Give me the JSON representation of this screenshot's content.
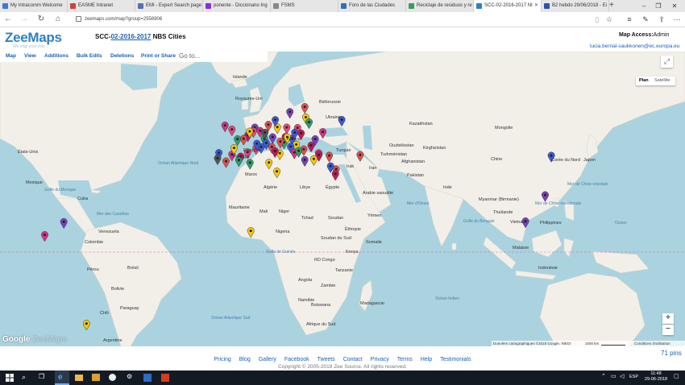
{
  "browser": {
    "tabs": [
      {
        "title": "My Intracomm Welcome",
        "color": "#3a7bd5"
      },
      {
        "title": "EASME Intranet",
        "color": "#d04040"
      },
      {
        "title": "EMI - Expert Search page",
        "color": "#5a6fb0"
      },
      {
        "title": "ponente - Diccionario Ing",
        "color": "#8a2be2"
      },
      {
        "title": "FSMS",
        "color": "#888888"
      },
      {
        "title": "Foro de las Ciudades",
        "color": "#2f6fb5"
      },
      {
        "title": "Reciclaje de residuos y re",
        "color": "#3a9c5a"
      },
      {
        "title": "SCC-02-2016-2017 NI",
        "color": "#2f7fc4",
        "active": true
      },
      {
        "title": "B2 hebdo 29/06/2018 - Ei",
        "color": "#2f4fb5"
      }
    ],
    "url": "zeemaps.com/map?group=2558906"
  },
  "site": {
    "logo": "ZeeMaps",
    "tagline": "We map your lists",
    "title_prefix": "SCC-",
    "title_link": "02-2016-2017",
    "title_suffix": " NBS Cities",
    "access_label": "Map Access:",
    "access_value": "Admin",
    "user_email": "lucia.bernal-saukkonen@ec.europa.eu"
  },
  "menu": {
    "items": [
      "Map",
      "View",
      "Additions",
      "Bulk Edits",
      "Deletions",
      "Print or Share"
    ],
    "goto_placeholder": "Go to..."
  },
  "map": {
    "type_plan": "Plan",
    "type_satellite": "Satellite",
    "zoom_in": "+",
    "zoom_out": "−",
    "google": "Google",
    "zeemaps_watermark": "ZeeMaps",
    "attribution": "Données cartographiques ©2018 Google, INEGI",
    "scale": "1000 km",
    "terms": "Conditions d'utilisation",
    "labels": {
      "iceland": "Islande",
      "uk": "Royaume-Uni",
      "belarus": "Biélorussie",
      "ukraine": "Ukraine",
      "kazakhstan": "Kazakhstan",
      "mongolia": "Mongolie",
      "uzbekistan": "Ouzbékistan",
      "turkmenistan": "Turkménistan",
      "kyrgyzstan": "Kirghizistan",
      "france": "France",
      "spain": "Espagne",
      "portugal": "Portugal",
      "turkey": "Turquie",
      "iran": "Iran",
      "afghanistan": "Afghanistan",
      "pakistan": "Pakistan",
      "china": "Chine",
      "nkorea": "Corée du Nord",
      "japan": "Japon",
      "morocco": "Maroc",
      "algeria": "Algérie",
      "libya": "Libye",
      "egypt": "Égypte",
      "iraq": "Irak",
      "saudi": "Arabie saoudite",
      "india": "Inde",
      "myanmar": "Myanmar (Birmanie)",
      "thailand": "Thaïlande",
      "vietnam": "Vietnam",
      "philippines": "Philippines",
      "malaysia": "Malaisie",
      "indonesia": "Indonésie",
      "mauritania": "Mauritanie",
      "mali": "Mali",
      "niger": "Niger",
      "chad": "Tchad",
      "sudan": "Soudan",
      "nigeria": "Nigeria",
      "ethiopia": "Éthiopie",
      "yemen": "Yémen",
      "ssudan": "Soudan du Sud",
      "kenya": "Kenya",
      "somalia": "Somalie",
      "drc": "RD Congo",
      "tanzania": "Tanzanie",
      "angola": "Angola",
      "zambia": "Zambie",
      "namibia": "Namibie",
      "botswana": "Botswana",
      "madagascar": "Madagascar",
      "safrica": "Afrique du Sud",
      "usa": "États-Unis",
      "mexico": "Mexique",
      "cuba": "Cuba",
      "venezuela": "Venezuela",
      "colombia": "Colombie",
      "peru": "Pérou",
      "brazil": "Brésil",
      "bolivia": "Bolivie",
      "paraguay": "Paraguay",
      "chile": "Chili",
      "argentina": "Argentine",
      "atlantic_n": "Océan Atlantique Nord",
      "atlantic_s": "Océan Atlantique Sud",
      "indian": "Océan Indien",
      "gulf_mexico": "Golfe du Mexique",
      "caribbean": "Mer des Caraïbes",
      "gulf_guinea": "Golfe de Guinée",
      "arabian_sea": "Mer d'Oman",
      "bengal": "Golfe du Bengale",
      "scs": "Mer de Chine méridionale",
      "ecs": "Mer de Chine orientale",
      "ocean_n": "Océan"
    }
  },
  "footer": {
    "links": [
      "Pricing",
      "Blog",
      "Gallery",
      "Facebook",
      "Tweets",
      "Contact",
      "Privacy",
      "Terms",
      "Help",
      "Testimonials"
    ],
    "pin_count": "71 pins",
    "copyright": "Copyright © 2005-2018 Zee Source. All rights reserved."
  },
  "taskbar": {
    "time": "11:48",
    "date": "29-06-2018",
    "lang": "ESP"
  },
  "pins": [
    {
      "lon": 37.6,
      "lat": 55.8,
      "color": "#3b5bdb"
    },
    {
      "lon": -3.7,
      "lat": 51.5,
      "color": "#e8467c"
    },
    {
      "lon": -6.3,
      "lat": 53.3,
      "color": "#d63384"
    },
    {
      "lon": 2.3,
      "lat": 48.9,
      "color": "#c2185b"
    },
    {
      "lon": 4.9,
      "lat": 52.4,
      "color": "#7b3fbf"
    },
    {
      "lon": 13.4,
      "lat": 52.5,
      "color": "#f6c90e"
    },
    {
      "lon": 16.4,
      "lat": 48.2,
      "color": "#c2185b"
    },
    {
      "lon": 19.0,
      "lat": 47.5,
      "color": "#3b5bdb"
    },
    {
      "lon": 21.0,
      "lat": 52.2,
      "color": "#e8467c"
    },
    {
      "lon": 24.1,
      "lat": 56.9,
      "color": "#f6c90e"
    },
    {
      "lon": 10.0,
      "lat": 53.6,
      "color": "#e05050"
    },
    {
      "lon": 12.6,
      "lat": 55.7,
      "color": "#3b5bdb"
    },
    {
      "lon": 8.5,
      "lat": 47.4,
      "color": "#2e9e6b"
    },
    {
      "lon": 11.3,
      "lat": 43.8,
      "color": "#e05050"
    },
    {
      "lon": 14.3,
      "lat": 40.9,
      "color": "#f6c90e"
    },
    {
      "lon": 9.2,
      "lat": 45.5,
      "color": "#3b5bdb"
    },
    {
      "lon": 12.5,
      "lat": 41.9,
      "color": "#c2185b"
    },
    {
      "lon": 15.9,
      "lat": 45.8,
      "color": "#2e9e6b"
    },
    {
      "lon": 20.5,
      "lat": 44.8,
      "color": "#f6c90e"
    },
    {
      "lon": 23.3,
      "lat": 42.7,
      "color": "#e05050"
    },
    {
      "lon": 26.1,
      "lat": 44.4,
      "color": "#c2185b"
    },
    {
      "lon": 23.7,
      "lat": 38.0,
      "color": "#7b3fbf"
    },
    {
      "lon": 28.9,
      "lat": 41.0,
      "color": "#d63384"
    },
    {
      "lon": 35.5,
      "lat": 33.9,
      "color": "#e05050"
    },
    {
      "lon": -3.7,
      "lat": 40.4,
      "color": "#d63384"
    },
    {
      "lon": -0.4,
      "lat": 39.5,
      "color": "#c2185b"
    },
    {
      "lon": 2.2,
      "lat": 41.4,
      "color": "#e8467c"
    },
    {
      "lon": -8.6,
      "lat": 41.1,
      "color": "#3b5bdb"
    },
    {
      "lon": -9.1,
      "lat": 38.7,
      "color": "#555555"
    },
    {
      "lon": -5.9,
      "lat": 37.4,
      "color": "#e05050"
    },
    {
      "lon": -1.1,
      "lat": 37.9,
      "color": "#2e9e6b"
    },
    {
      "lon": 5.4,
      "lat": 43.3,
      "color": "#e8467c"
    },
    {
      "lon": 7.3,
      "lat": 43.7,
      "color": "#3b5bdb"
    },
    {
      "lon": 10.2,
      "lat": 36.8,
      "color": "#f6c90e"
    },
    {
      "lon": 3.1,
      "lat": 36.7,
      "color": "#2e9e6b"
    },
    {
      "lon": 30.5,
      "lat": 50.4,
      "color": "#d63384"
    },
    {
      "lon": 25.3,
      "lat": 54.7,
      "color": "#2e9e6b"
    },
    {
      "lon": 22.3,
      "lat": 49.8,
      "color": "#c2185b"
    },
    {
      "lon": 17.1,
      "lat": 48.1,
      "color": "#f6c90e"
    },
    {
      "lon": 14.5,
      "lat": 46.1,
      "color": "#e05050"
    },
    {
      "lon": 18.4,
      "lat": 43.9,
      "color": "#3b5bdb"
    },
    {
      "lon": 19.8,
      "lat": 41.3,
      "color": "#d63384"
    },
    {
      "lon": 21.4,
      "lat": 42.0,
      "color": "#2e9e6b"
    },
    {
      "lon": 27.6,
      "lat": 47.2,
      "color": "#7b3fbf"
    },
    {
      "lon": 32.9,
      "lat": 39.9,
      "color": "#e05050"
    },
    {
      "lon": 29.0,
      "lat": 40.2,
      "color": "#c2185b"
    },
    {
      "lon": 27.1,
      "lat": 38.4,
      "color": "#f6c90e"
    },
    {
      "lon": 33.4,
      "lat": 35.2,
      "color": "#3b5bdb"
    },
    {
      "lon": 6.9,
      "lat": 50.9,
      "color": "#d63384"
    },
    {
      "lon": 4.4,
      "lat": 50.8,
      "color": "#e8467c"
    },
    {
      "lon": 8.7,
      "lat": 50.1,
      "color": "#555555"
    },
    {
      "lon": 11.6,
      "lat": 48.1,
      "color": "#7b3fbf"
    },
    {
      "lon": 3.0,
      "lat": 50.6,
      "color": "#f6c90e"
    },
    {
      "lon": -1.6,
      "lat": 47.2,
      "color": "#2e9e6b"
    },
    {
      "lon": 0.7,
      "lat": 47.4,
      "color": "#e05050"
    },
    {
      "lon": 5.7,
      "lat": 45.2,
      "color": "#3b5bdb"
    },
    {
      "lon": -2.9,
      "lat": 43.3,
      "color": "#f6c90e"
    },
    {
      "lon": 16.9,
      "lat": 52.4,
      "color": "#e8467c"
    },
    {
      "lon": 19.9,
      "lat": 50.1,
      "color": "#3b5bdb"
    },
    {
      "lon": 13.2,
      "lat": 32.9,
      "color": "#f6c90e"
    },
    {
      "lon": 23.7,
      "lat": 61.5,
      "color": "#e05050"
    },
    {
      "lon": 106.7,
      "lat": 10.8,
      "color": "#7b3fbf"
    },
    {
      "lon": 116.4,
      "lat": 39.9,
      "color": "#3b5bdb"
    },
    {
      "lon": 114.1,
      "lat": 22.4,
      "color": "#7b3fbf"
    },
    {
      "lon": -74.1,
      "lat": 4.7,
      "color": "#d63384"
    },
    {
      "lon": -66.9,
      "lat": 10.5,
      "color": "#7b3fbf"
    },
    {
      "lon": -58.4,
      "lat": -34.6,
      "color": "#f6c90e"
    },
    {
      "lon": 3.4,
      "lat": 6.5,
      "color": "#f6c90e"
    },
    {
      "lon": 44.5,
      "lat": 40.2,
      "color": "#e05050"
    },
    {
      "lon": 35.2,
      "lat": 31.8,
      "color": "#c2185b"
    },
    {
      "lon": 18.1,
      "lat": 59.3,
      "color": "#7b3fbf"
    }
  ]
}
